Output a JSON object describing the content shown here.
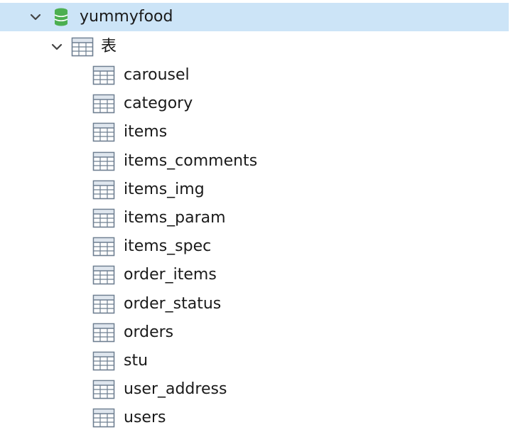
{
  "database": {
    "name": "yummyfood",
    "icon": "database-icon",
    "icon_color": "#4caf50",
    "expanded": true
  },
  "tables_folder": {
    "label": "表",
    "icon": "table-folder-icon",
    "expanded": true
  },
  "tables": [
    {
      "name": "carousel"
    },
    {
      "name": "category"
    },
    {
      "name": "items"
    },
    {
      "name": "items_comments"
    },
    {
      "name": "items_img"
    },
    {
      "name": "items_param"
    },
    {
      "name": "items_spec"
    },
    {
      "name": "order_items"
    },
    {
      "name": "order_status"
    },
    {
      "name": "orders"
    },
    {
      "name": "stu"
    },
    {
      "name": "user_address"
    },
    {
      "name": "users"
    }
  ],
  "colors": {
    "selection": "#cce4f7",
    "table_icon_stroke": "#6e7f91",
    "table_icon_header": "#dfe6ee"
  }
}
